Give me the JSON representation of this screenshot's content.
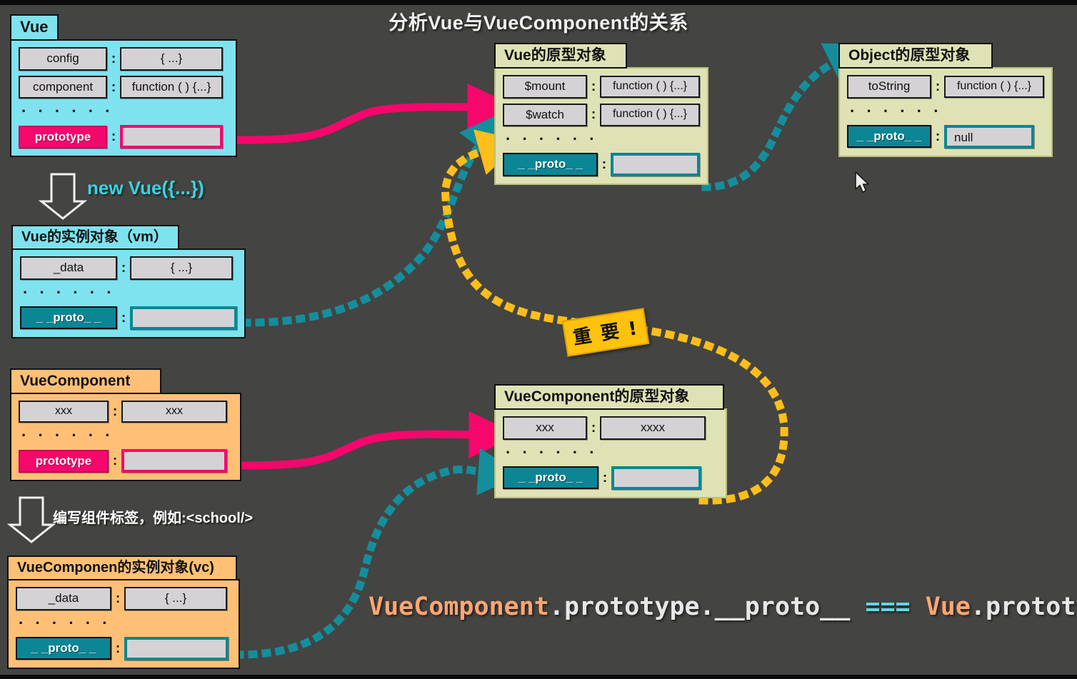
{
  "page": {
    "title": "分析Vue与VueComponent的关系",
    "background_color": "#444442"
  },
  "colors": {
    "cyan_card": "#7fe2ef",
    "orange_card": "#ffc076",
    "olive_card": "#dfe2b4",
    "pink_accent": "#f5076c",
    "teal_accent": "#0b8695",
    "yellow_accent": "#ffc20e",
    "cell_gray": "#d4d2d4"
  },
  "cards": {
    "vue": {
      "title": "Vue",
      "rows": [
        {
          "key": "config",
          "value": "{ ...}"
        },
        {
          "key": "component",
          "value": "function ( ) {...}"
        }
      ],
      "ellipsis": "· · · · · ·",
      "proto_key": "prototype",
      "proto_value": ""
    },
    "vm": {
      "title": "Vue的实例对象（vm）",
      "rows": [
        {
          "key": "_data",
          "value": "{ ...}"
        }
      ],
      "ellipsis": "· · · · · ·",
      "proto_key": "_ _proto_ _",
      "proto_value": ""
    },
    "vue_component": {
      "title": "VueComponent",
      "rows": [
        {
          "key": "xxx",
          "value": "xxx"
        }
      ],
      "ellipsis": "· · · · · ·",
      "proto_key": "prototype",
      "proto_value": ""
    },
    "vc": {
      "title": "VueComponen的实例对象(vc)",
      "rows": [
        {
          "key": "_data",
          "value": "{ ...}"
        }
      ],
      "ellipsis": "· · · · · ·",
      "proto_key": "_ _proto_ _",
      "proto_value": ""
    },
    "vue_prototype": {
      "title": "Vue的原型对象",
      "rows": [
        {
          "key": "$mount",
          "value": "function ( ) {...}"
        },
        {
          "key": "$watch",
          "value": "function ( ) {...}"
        }
      ],
      "ellipsis": "· · · · · ·",
      "proto_key": "_ _proto_ _",
      "proto_value": ""
    },
    "vue_component_prototype": {
      "title": "VueComponent的原型对象",
      "rows": [
        {
          "key": "xxx",
          "value": "xxxx"
        }
      ],
      "ellipsis": "· · · · · ·",
      "proto_key": "_ _proto_ _",
      "proto_value": ""
    },
    "object_prototype": {
      "title": "Object的原型对象",
      "rows": [
        {
          "key": "toString",
          "value": "function ( ) {...}"
        }
      ],
      "ellipsis": "· · · · · ·",
      "proto_key": "_ _proto_ _",
      "proto_value": "null"
    }
  },
  "annotations": {
    "new_vue": "new Vue({...})",
    "write_tag": "编写组件标签，例如:<school/>",
    "important_sticker": "重 要 !"
  },
  "code_line": {
    "part1": "VueComponent",
    "part2": ".prototype.__proto__",
    "part3": "===",
    "part4": "Vue",
    "part5": ".prototype"
  }
}
